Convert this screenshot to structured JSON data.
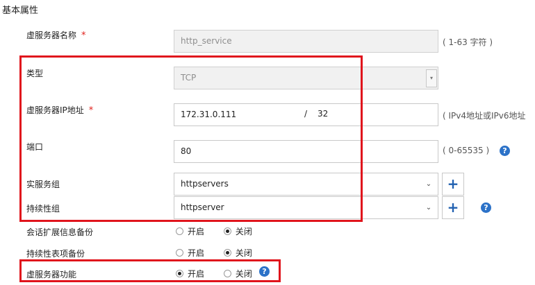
{
  "section_title": "基本属性",
  "required_mark": "*",
  "fields": {
    "vs_name": {
      "label": "虚服务器名称",
      "value": "http_service",
      "hint": "( 1-63 字符 )"
    },
    "type": {
      "label": "类型",
      "value": "TCP",
      "arrow": "▾"
    },
    "vs_ip": {
      "label": "虚服务器IP地址",
      "ip": "172.31.0.111",
      "slash": "/",
      "prefix": "32",
      "hint": "( IPv4地址或IPv6地址"
    },
    "port": {
      "label": "端口",
      "value": "80",
      "hint": "( 0-65535 )"
    },
    "real_group": {
      "label": "实服务组",
      "value": "httpservers",
      "chevron": "⌄",
      "add": "+"
    },
    "persist_group": {
      "label": "持续性组",
      "value": "httpserver",
      "chevron": "⌄",
      "add": "+"
    }
  },
  "radios": {
    "session_backup": {
      "label": "会话扩展信息备份",
      "on_label": "开启",
      "off_label": "关闭",
      "selected": "off"
    },
    "persist_backup": {
      "label": "持续性表项备份",
      "on_label": "开启",
      "off_label": "关闭",
      "selected": "off"
    },
    "vs_function": {
      "label": "虚服务器功能",
      "on_label": "开启",
      "off_label": "关闭",
      "selected": "on"
    }
  },
  "help_glyph": "?",
  "colors": {
    "highlight": "#e0141c",
    "help": "#2c72c8",
    "required": "#e0201b"
  }
}
